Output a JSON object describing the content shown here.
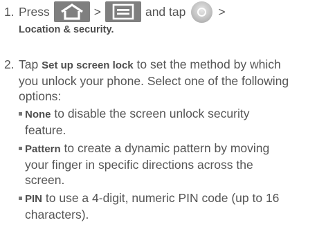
{
  "step1": {
    "number": "1.",
    "press": "Press",
    "gt1": ">",
    "and_tap": "and tap",
    "gt2": ">",
    "location_security": "Location & security",
    "period": ".",
    "icons": [
      "home-icon",
      "menu-icon",
      "settings-icon"
    ]
  },
  "step2": {
    "number": "2.",
    "tap": "Tap",
    "set_up_screen_lock": "Set up screen lock",
    "text_line1": "to set the method by which",
    "text_line2": "you unlock your phone. Select one of the following",
    "text_line3": "options:"
  },
  "options": [
    {
      "label": "None",
      "line1": " to disable the screen unlock security",
      "line2": "feature.",
      "line3": ""
    },
    {
      "label": "Pattern",
      "line1": " to create a dynamic pattern by moving",
      "line2": "your finger in specific directions across the",
      "line3": "screen."
    },
    {
      "label": "PIN",
      "line1": " to use a 4-digit, numeric PIN code (up to 16",
      "line2": "characters).",
      "line3": ""
    }
  ]
}
